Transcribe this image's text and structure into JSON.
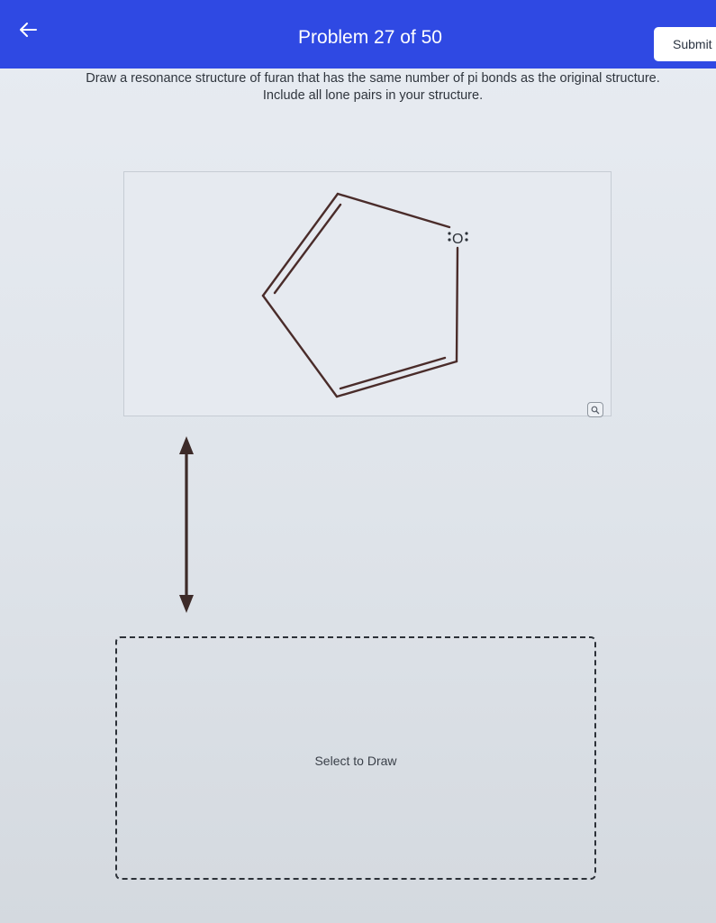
{
  "header": {
    "title": "Problem 27 of 50",
    "submit_label": "Submit",
    "back_icon": "arrow-left-icon"
  },
  "instructions": {
    "line1": "Draw a resonance structure of furan that has the same number of pi bonds as the original structure.",
    "line2": "Include all lone pairs in your structure."
  },
  "structure": {
    "atom_label": "O",
    "zoom_icon": "magnifier-icon"
  },
  "draw_area": {
    "label": "Select to Draw"
  },
  "colors": {
    "header": "#2f49e3",
    "bond": "#4a2c2a",
    "arrow": "#3d2b29"
  }
}
